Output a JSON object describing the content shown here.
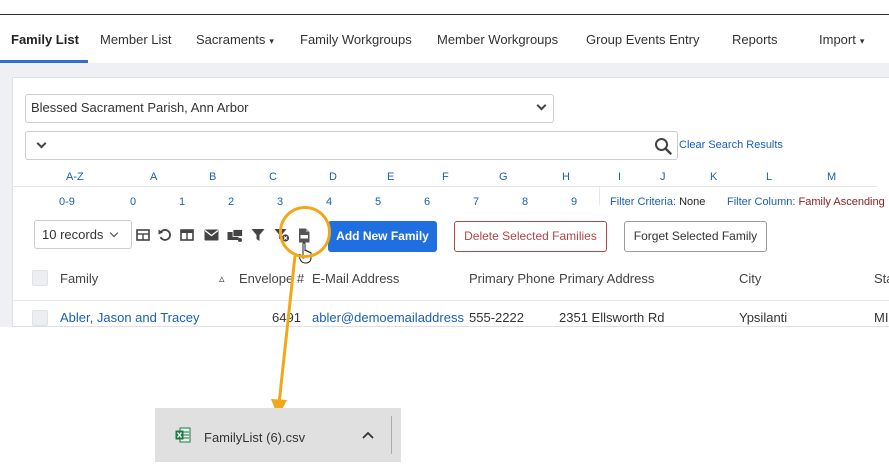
{
  "nav": {
    "items": [
      {
        "label": "Family List",
        "active": true
      },
      {
        "label": "Member List"
      },
      {
        "label": "Sacraments",
        "caret": "▾"
      },
      {
        "label": "Family Workgroups"
      },
      {
        "label": "Member Workgroups"
      },
      {
        "label": "Group Events Entry"
      },
      {
        "label": "Reports"
      },
      {
        "label": "Import",
        "caret": "▾"
      }
    ]
  },
  "parish_select": {
    "value": "Blessed Sacrament Parish, Ann Arbor"
  },
  "search": {
    "clear_label": "Clear Search Results",
    "icon": "search-icon"
  },
  "letters_row1": [
    "A-Z",
    "A",
    "B",
    "C",
    "D",
    "E",
    "F",
    "G",
    "H",
    "I",
    "J",
    "K",
    "L",
    "M"
  ],
  "letters_row2": [
    "0-9",
    "0",
    "1",
    "2",
    "3",
    "4",
    "5",
    "6",
    "7",
    "8",
    "9"
  ],
  "filter": {
    "criteria_label": "Filter Criteria:",
    "criteria_value": "None",
    "column_label": "Filter Column:",
    "column_value": "Family Ascending"
  },
  "toolbar": {
    "records_value": "10 records",
    "add_label": "Add New Family",
    "delete_label": "Delete Selected Families",
    "forget_label": "Forget Selected Family",
    "icons": [
      "table-icon",
      "undo-icon",
      "columns-icon",
      "email-icon",
      "mail-merge-icon",
      "filter-icon",
      "clear-filter-icon",
      "csv-export-icon"
    ]
  },
  "table": {
    "headers": [
      "Family",
      "Envelope #",
      "E-Mail Address",
      "Primary Phone",
      "Primary Address",
      "City",
      "Sta"
    ],
    "sort_indicator": "▵",
    "rows": [
      [
        "Abler, Jason and Tracey",
        "6491",
        "abler@demoemailaddress",
        "555-2222",
        "2351 Ellsworth Rd",
        "Ypsilanti",
        "MI"
      ]
    ]
  },
  "download": {
    "filename": "FamilyList (6).csv",
    "icon": "excel-file-icon"
  },
  "colors": {
    "accent": "#1f6fe0",
    "link": "#1a5fb4",
    "danger": "#b04646",
    "annotation": "#f0a81a"
  }
}
